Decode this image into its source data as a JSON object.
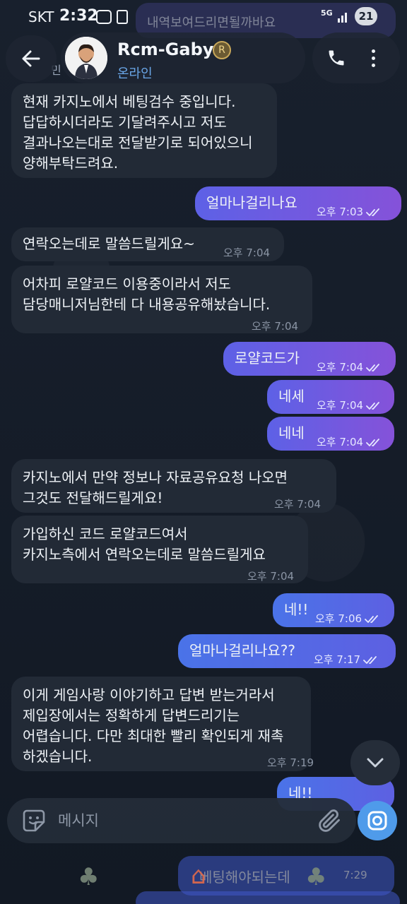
{
  "status_bar": {
    "carrier": "SKT",
    "time": "2:32",
    "network": "5G",
    "battery": "21"
  },
  "header": {
    "back_icon": "arrow-left-icon",
    "contact_name": "Rcm-Gaby",
    "badge_icon": "crown-badge-icon",
    "badge_letter": "R",
    "contact_status": "온라인",
    "call_icon": "phone-icon",
    "more_icon": "more-vertical-icon"
  },
  "background": {
    "top_faint_message": "내역보여드리면될까바요",
    "top_faint_left": "민"
  },
  "messages": [
    {
      "dir": "in",
      "text": "현재 카지노에서 베팅검수 중입니다.\n답답하시더라도 기달려주시고 저도\n결과나오는대로 전달받기로 되어있으니\n양해부탁드려요.",
      "time": "오후 7:03"
    },
    {
      "dir": "out",
      "text": "얼마나걸리나요",
      "time": "오후 7:03"
    },
    {
      "dir": "in",
      "text": "연락오는데로 말씀드릴게요~",
      "time": "오후 7:04"
    },
    {
      "dir": "in",
      "text": "어차피 로얄코드 이용중이라서 저도\n담당매니저님한테 다 내용공유해놨습니다.",
      "time": "오후 7:04"
    },
    {
      "dir": "out",
      "text": "로얄코드가",
      "time": "오후 7:04"
    },
    {
      "dir": "out",
      "text": "네세",
      "time": "오후 7:04"
    },
    {
      "dir": "out",
      "text": "네네",
      "time": "오후 7:04"
    },
    {
      "dir": "in",
      "text": "카지노에서 만약 정보나 자료공유요청 나오면\n그것도 전달해드릴게요!",
      "time": "오후 7:04"
    },
    {
      "dir": "in",
      "text": "가입하신 코드 로얄코드여서\n카지노측에서 연락오는데로 말씀드릴게요",
      "time": "오후 7:04"
    },
    {
      "dir": "out",
      "text": "네!!",
      "time": "오후 7:06"
    },
    {
      "dir": "out",
      "text": "얼마나걸리나요??",
      "time": "오후 7:17"
    },
    {
      "dir": "in",
      "text": "이게 게임사랑 이야기하고 답변 받는거라서\n제입장에서는 정확하게 답변드리기는\n어렵습니다. 다만 최대한 빨리 확인되게 재촉\n하겠습니다.",
      "time": "오후 7:19"
    },
    {
      "dir": "out",
      "text": "네!!",
      "time": ""
    }
  ],
  "bottom_faint": {
    "text": "베팅해야되는데",
    "time": "7:29"
  },
  "scroll_down_icon": "chevron-down-icon",
  "composer": {
    "emoji_icon": "sticker-icon",
    "placeholder": "메시지",
    "value": "",
    "attach_icon": "paperclip-icon",
    "camera_icon": "camera-icon"
  },
  "colors": {
    "background": "#141b26",
    "incoming_bubble": "#222a36",
    "outgoing_purple": "#7a55dd",
    "outgoing_blue": "#4f6ee6",
    "status_online": "#6aa7e8",
    "camera_button": "#4f9bea"
  }
}
